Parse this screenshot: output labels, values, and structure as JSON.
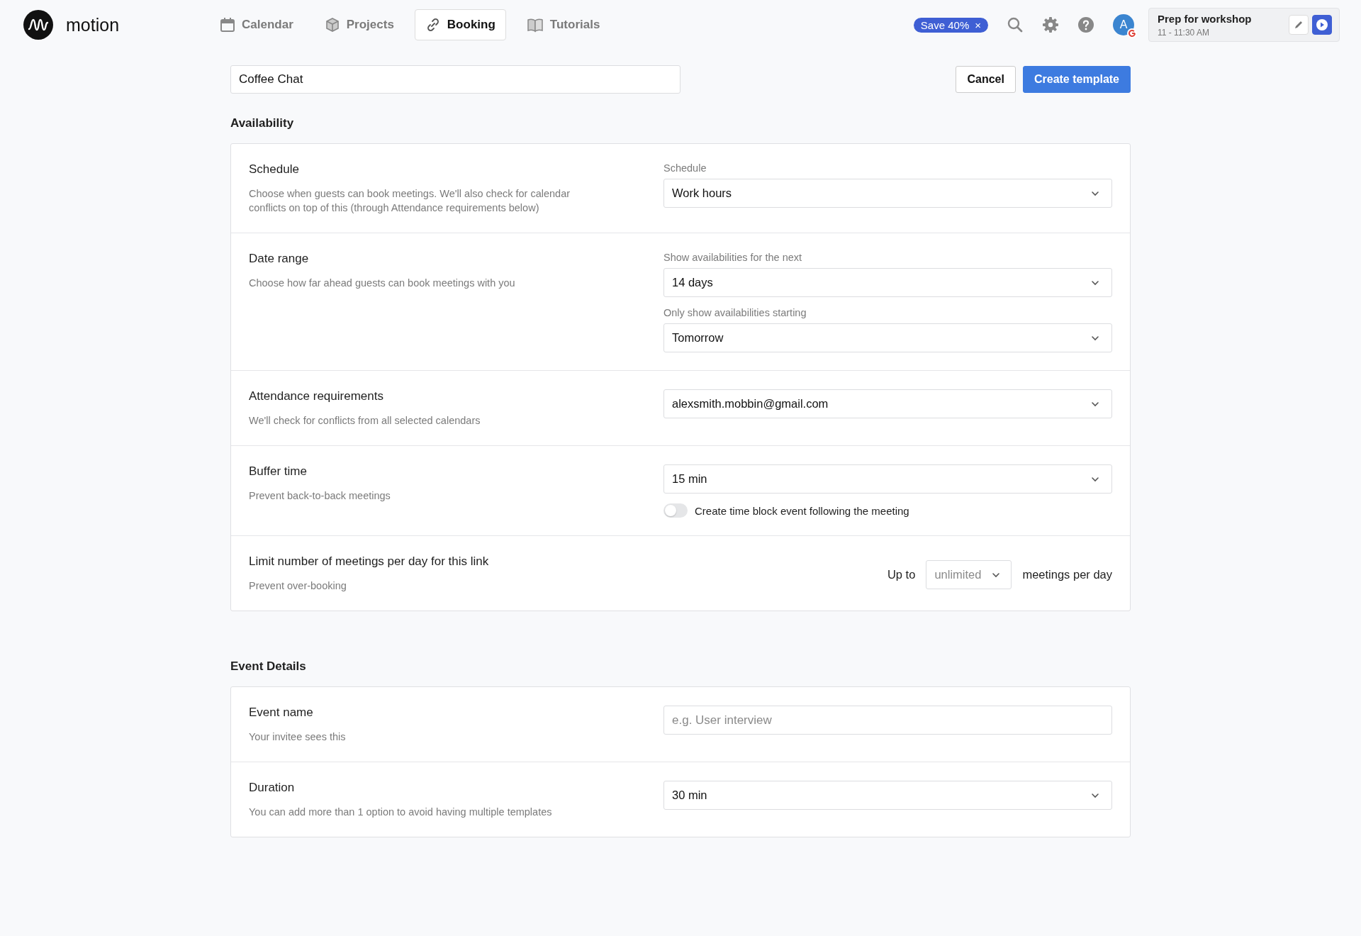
{
  "brand": {
    "name": "motion"
  },
  "nav": [
    {
      "label": "Calendar",
      "kind": "calendar",
      "selected": false
    },
    {
      "label": "Projects",
      "kind": "cube",
      "selected": false
    },
    {
      "label": "Booking",
      "kind": "link",
      "selected": true
    },
    {
      "label": "Tutorials",
      "kind": "book",
      "selected": false
    }
  ],
  "promo_badge": {
    "label": "Save 40%",
    "close": "×"
  },
  "avatar": {
    "initial": "A"
  },
  "upcoming_event": {
    "title": "Prep for workshop",
    "time": "11 - 11:30 AM"
  },
  "template_name": {
    "value": "Coffee Chat"
  },
  "buttons": [
    {
      "label": "Cancel",
      "kind": "secondary"
    },
    {
      "label": "Create template",
      "kind": "primary"
    }
  ],
  "sections": [
    {
      "title": "Availability",
      "rows": [
        {
          "title": "Schedule",
          "description": "Choose when guests can book meetings. We'll also check for calendar conflicts on top of this (through Attendance requirements below)",
          "controls": [
            {
              "kind": "select",
              "label": "Schedule",
              "value": "Work hours"
            }
          ]
        },
        {
          "title": "Date range",
          "description": "Choose how far ahead guests can book meetings with you",
          "controls": [
            {
              "kind": "select",
              "label": "Show availabilities for the next",
              "value": "14 days"
            },
            {
              "kind": "select",
              "label": "Only show availabilities starting",
              "value": "Tomorrow"
            }
          ]
        },
        {
          "title": "Attendance requirements",
          "description": "We'll check for conflicts from all selected calendars",
          "controls": [
            {
              "kind": "select",
              "value": "alexsmith.mobbin@gmail.com"
            }
          ]
        },
        {
          "title": "Buffer time",
          "description": "Prevent back-to-back meetings",
          "controls": [
            {
              "kind": "select",
              "value": "15 min"
            },
            {
              "kind": "toggle",
              "label": "Create time block event following the meeting",
              "on": false
            }
          ]
        },
        {
          "title": "Limit number of meetings per day for this link",
          "description": "Prevent over-booking",
          "controls": [
            {
              "kind": "inline_select",
              "prefix": "Up to",
              "placeholder": "unlimited",
              "suffix": "meetings per day"
            }
          ]
        }
      ]
    },
    {
      "title": "Event Details",
      "rows": [
        {
          "title": "Event name",
          "description": "Your invitee sees this",
          "controls": [
            {
              "kind": "input",
              "placeholder": "e.g. User interview"
            }
          ]
        },
        {
          "title": "Duration",
          "description": "You can add more than 1 option to avoid having multiple templates",
          "controls": [
            {
              "kind": "select",
              "value": "30 min"
            }
          ]
        }
      ]
    }
  ]
}
